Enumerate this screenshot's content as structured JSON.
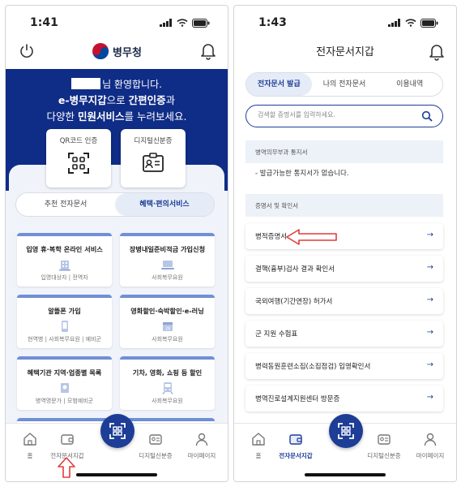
{
  "left": {
    "status": {
      "time": "1:41"
    },
    "header": {
      "brand": "병무청"
    },
    "hero": {
      "welcome_suffix": "님 환영합니다.",
      "line2_bold1": "e-병무지갑",
      "line2_mid": "으로 ",
      "line2_bold2": "간편인증",
      "line2_end": "과",
      "line3_start": "다양한 ",
      "line3_bold": "민원서비스",
      "line3_end": "를 누려보세요."
    },
    "quick": {
      "qr_label": "QR코드 인증",
      "digital_label": "디지털신분증"
    },
    "segment": {
      "tab1": "추천 전자문서",
      "tab2": "혜택·편의서비스"
    },
    "cards": [
      {
        "title": "입영 휴·복학 온라인 서비스",
        "sub": "입영대상자 | 전역자"
      },
      {
        "title": "장병내일준비적금 가입신청",
        "sub": "사회복무요원"
      },
      {
        "title": "알뜰폰 가입",
        "sub": "현역병 | 사회복무요원 | 예비군"
      },
      {
        "title": "영화할인·숙박할인·e-러닝",
        "sub": "사회복무요원"
      },
      {
        "title": "혜택기관 지역·업종별 목록",
        "sub": "병역명문가 | 모범예비군"
      },
      {
        "title": "기차, 영화, 쇼핑 등 할인",
        "sub": "사회복무요원"
      }
    ],
    "nav": {
      "home": "홈",
      "wallet": "전자문서지갑",
      "digital": "디지털신분증",
      "mypage": "마이페이지"
    }
  },
  "right": {
    "status": {
      "time": "1:43"
    },
    "title": "전자문서지갑",
    "segment": {
      "tab1": "전자문서 발급",
      "tab2": "나의 전자문서",
      "tab3": "이용내역"
    },
    "search": {
      "placeholder": "검색할 증명서를 입력하세요."
    },
    "notices": {
      "header": "병역의무부과 통지서",
      "empty": "- 발급가능한 통지서가 없습니다."
    },
    "certs": {
      "header": "증명서 및 확인서",
      "items": [
        "병적증명서",
        "결핵(흉부)검사 결과 확인서",
        "국외여행(기간연장) 허가서",
        "군 지원 수험표",
        "병력동원훈련소집(소집점검) 입영확인서",
        "병역진로설계지원센터 방문증"
      ]
    },
    "nav": {
      "home": "홈",
      "wallet": "전자문서지갑",
      "digital": "디지털신분증",
      "mypage": "마이페이지"
    }
  },
  "colors": {
    "navy": "#0f2c86",
    "accent": "#1d3d96",
    "highlight_arrow": "#e23b3b"
  },
  "icons": [
    "power-icon",
    "bell-icon",
    "qr-code-icon",
    "id-card-icon",
    "home-icon",
    "wallet-icon",
    "search-icon",
    "arrow-right-icon",
    "user-icon"
  ]
}
